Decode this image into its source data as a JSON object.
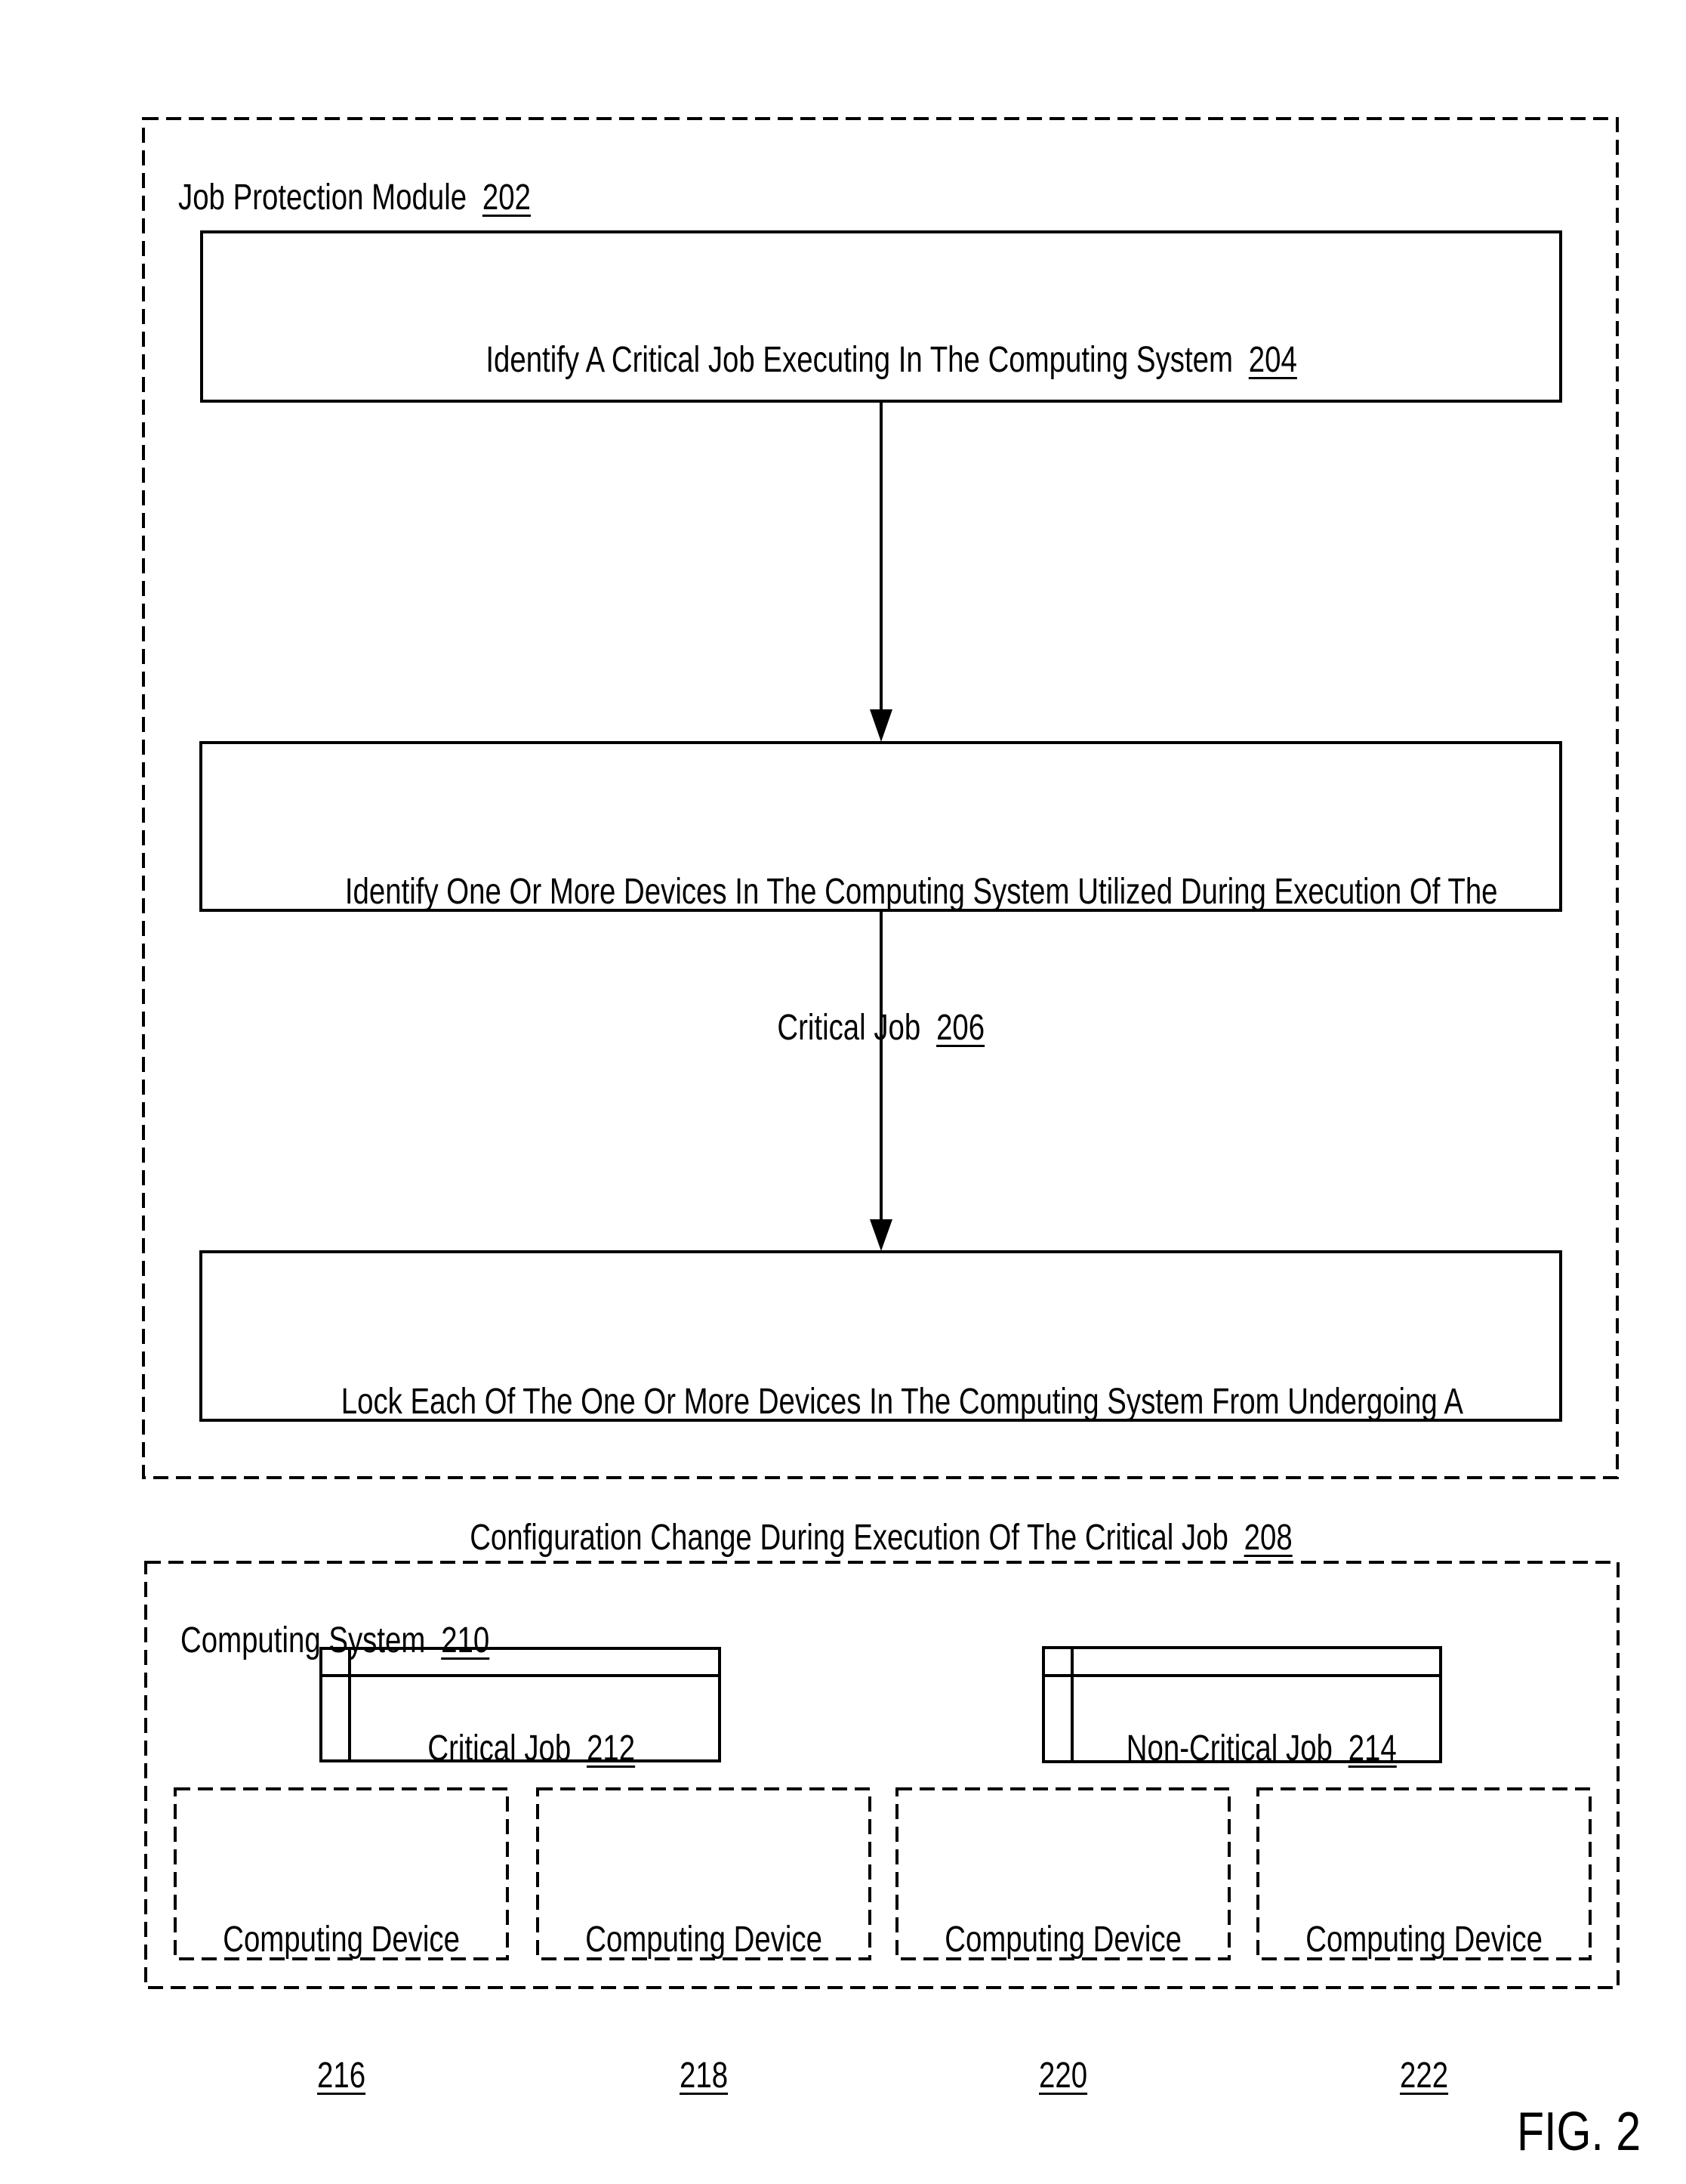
{
  "figure_label": "FIG. 2",
  "job_protection_module": {
    "title": "Job Protection Module",
    "ref": "202",
    "steps": [
      {
        "lines": [
          "Identify A Critical Job Executing In The Computing System"
        ],
        "ref": "204"
      },
      {
        "lines": [
          "Identify One Or More Devices In The Computing System Utilized During Execution Of The",
          "Critical Job"
        ],
        "ref": "206"
      },
      {
        "lines": [
          "Lock Each Of The One Or More Devices In The Computing System From Undergoing A",
          "Configuration Change During Execution Of The Critical Job"
        ],
        "ref": "208"
      }
    ]
  },
  "computing_system": {
    "title": "Computing System",
    "ref": "210",
    "jobs": [
      {
        "label": "Critical Job",
        "ref": "212"
      },
      {
        "label": "Non-Critical Job",
        "ref": "214"
      }
    ],
    "devices": [
      {
        "label": "Computing Device",
        "ref": "216"
      },
      {
        "label": "Computing Device",
        "ref": "218"
      },
      {
        "label": "Computing Device",
        "ref": "220"
      },
      {
        "label": "Computing Device",
        "ref": "222"
      }
    ]
  },
  "colors": {
    "stroke": "#000000",
    "background": "#ffffff"
  }
}
